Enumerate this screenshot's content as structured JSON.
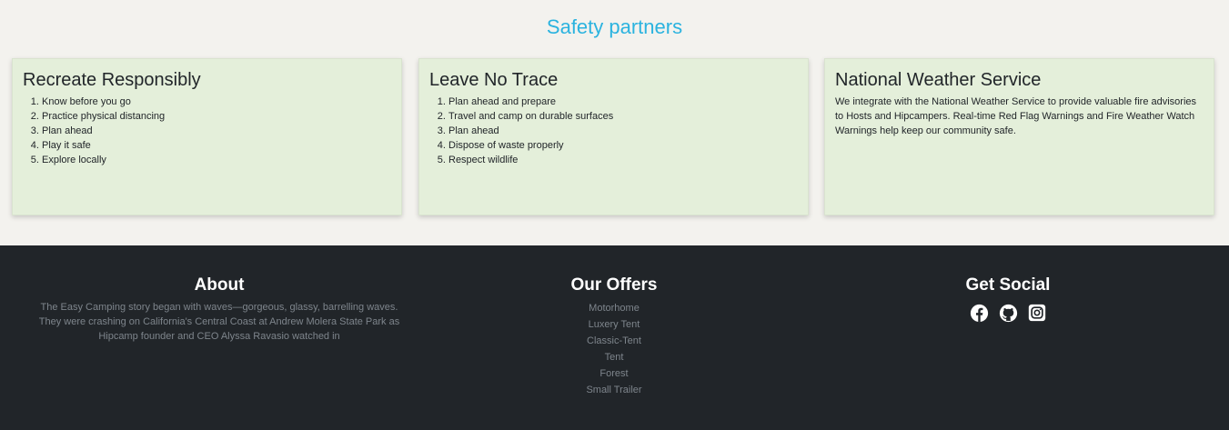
{
  "partners": {
    "title": "Safety partners",
    "cards": [
      {
        "title": "Recreate Responsibly",
        "items": [
          "Know before you go",
          "Practice physical distancing",
          "Plan ahead",
          "Play it safe",
          "Explore locally"
        ]
      },
      {
        "title": "Leave No Trace",
        "items": [
          "Plan ahead and prepare",
          "Travel and camp on durable surfaces",
          "Plan ahead",
          "Dispose of waste properly",
          "Respect wildlife"
        ]
      },
      {
        "title": "National Weather Service",
        "text": "We integrate with the National Weather Service to provide valuable fire advisories to Hosts and Hipcampers. Real-time Red Flag Warnings and Fire Weather Watch Warnings help keep our community safe."
      }
    ]
  },
  "footer": {
    "about": {
      "title": "About",
      "text": "The Easy Camping story began with waves—gorgeous, glassy, barrelling waves. They were crashing on California's Central Coast at Andrew Molera State Park as Hipcamp founder and CEO Alyssa Ravasio watched in"
    },
    "offers": {
      "title": "Our Offers",
      "items": [
        "Motorhome",
        "Luxery Tent",
        "Classic-Tent",
        "Tent",
        "Forest",
        "Small Trailer"
      ]
    },
    "social": {
      "title": "Get Social",
      "icons": [
        "facebook-icon",
        "github-icon",
        "instagram-icon"
      ]
    }
  },
  "colors": {
    "page_background": "#f3f2ee",
    "title_accent": "#2bb3df",
    "card_background": "#e4efda",
    "footer_background": "#212529",
    "footer_muted_text": "#7e858c"
  }
}
